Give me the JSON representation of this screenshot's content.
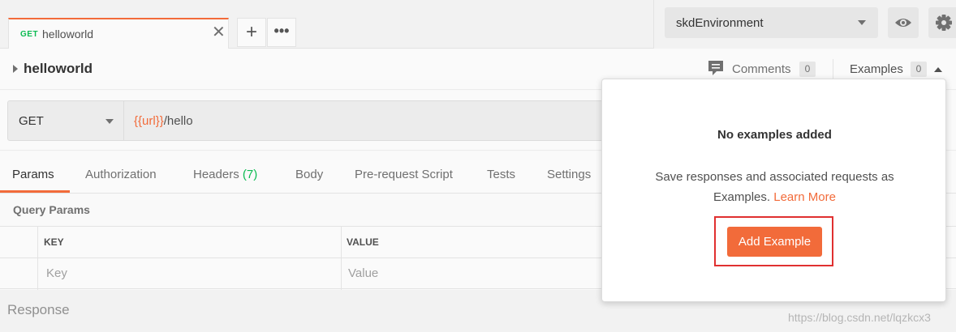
{
  "tab": {
    "method": "GET",
    "name": "helloworld",
    "close_glyph": "✕"
  },
  "tab_actions": {
    "new_tab_glyph": "+",
    "more_glyph": "•••"
  },
  "environment": {
    "selected": "skdEnvironment"
  },
  "request": {
    "title": "helloworld",
    "comments_label": "Comments",
    "comments_count": "0",
    "examples_label": "Examples",
    "examples_count": "0",
    "method": "GET",
    "url_var": "{{url}}",
    "url_path": "/hello"
  },
  "request_tabs": [
    {
      "label": "Params"
    },
    {
      "label": "Authorization"
    },
    {
      "label": "Headers",
      "count": "(7)"
    },
    {
      "label": "Body"
    },
    {
      "label": "Pre-request Script"
    },
    {
      "label": "Tests"
    },
    {
      "label": "Settings"
    }
  ],
  "query_params": {
    "title": "Query Params",
    "key_header": "KEY",
    "value_header": "VALUE",
    "key_placeholder": "Key",
    "value_placeholder": "Value"
  },
  "response": {
    "label": "Response"
  },
  "examples_popover": {
    "title": "No examples added",
    "description": "Save responses and associated requests as Examples.",
    "learn_more": "Learn More",
    "add_button": "Add Example"
  },
  "watermark": "https://blog.csdn.net/lqzkcx3",
  "colors": {
    "accent": "#f26b3a",
    "get_method": "#0cbb52",
    "highlight_box": "#e03030"
  }
}
